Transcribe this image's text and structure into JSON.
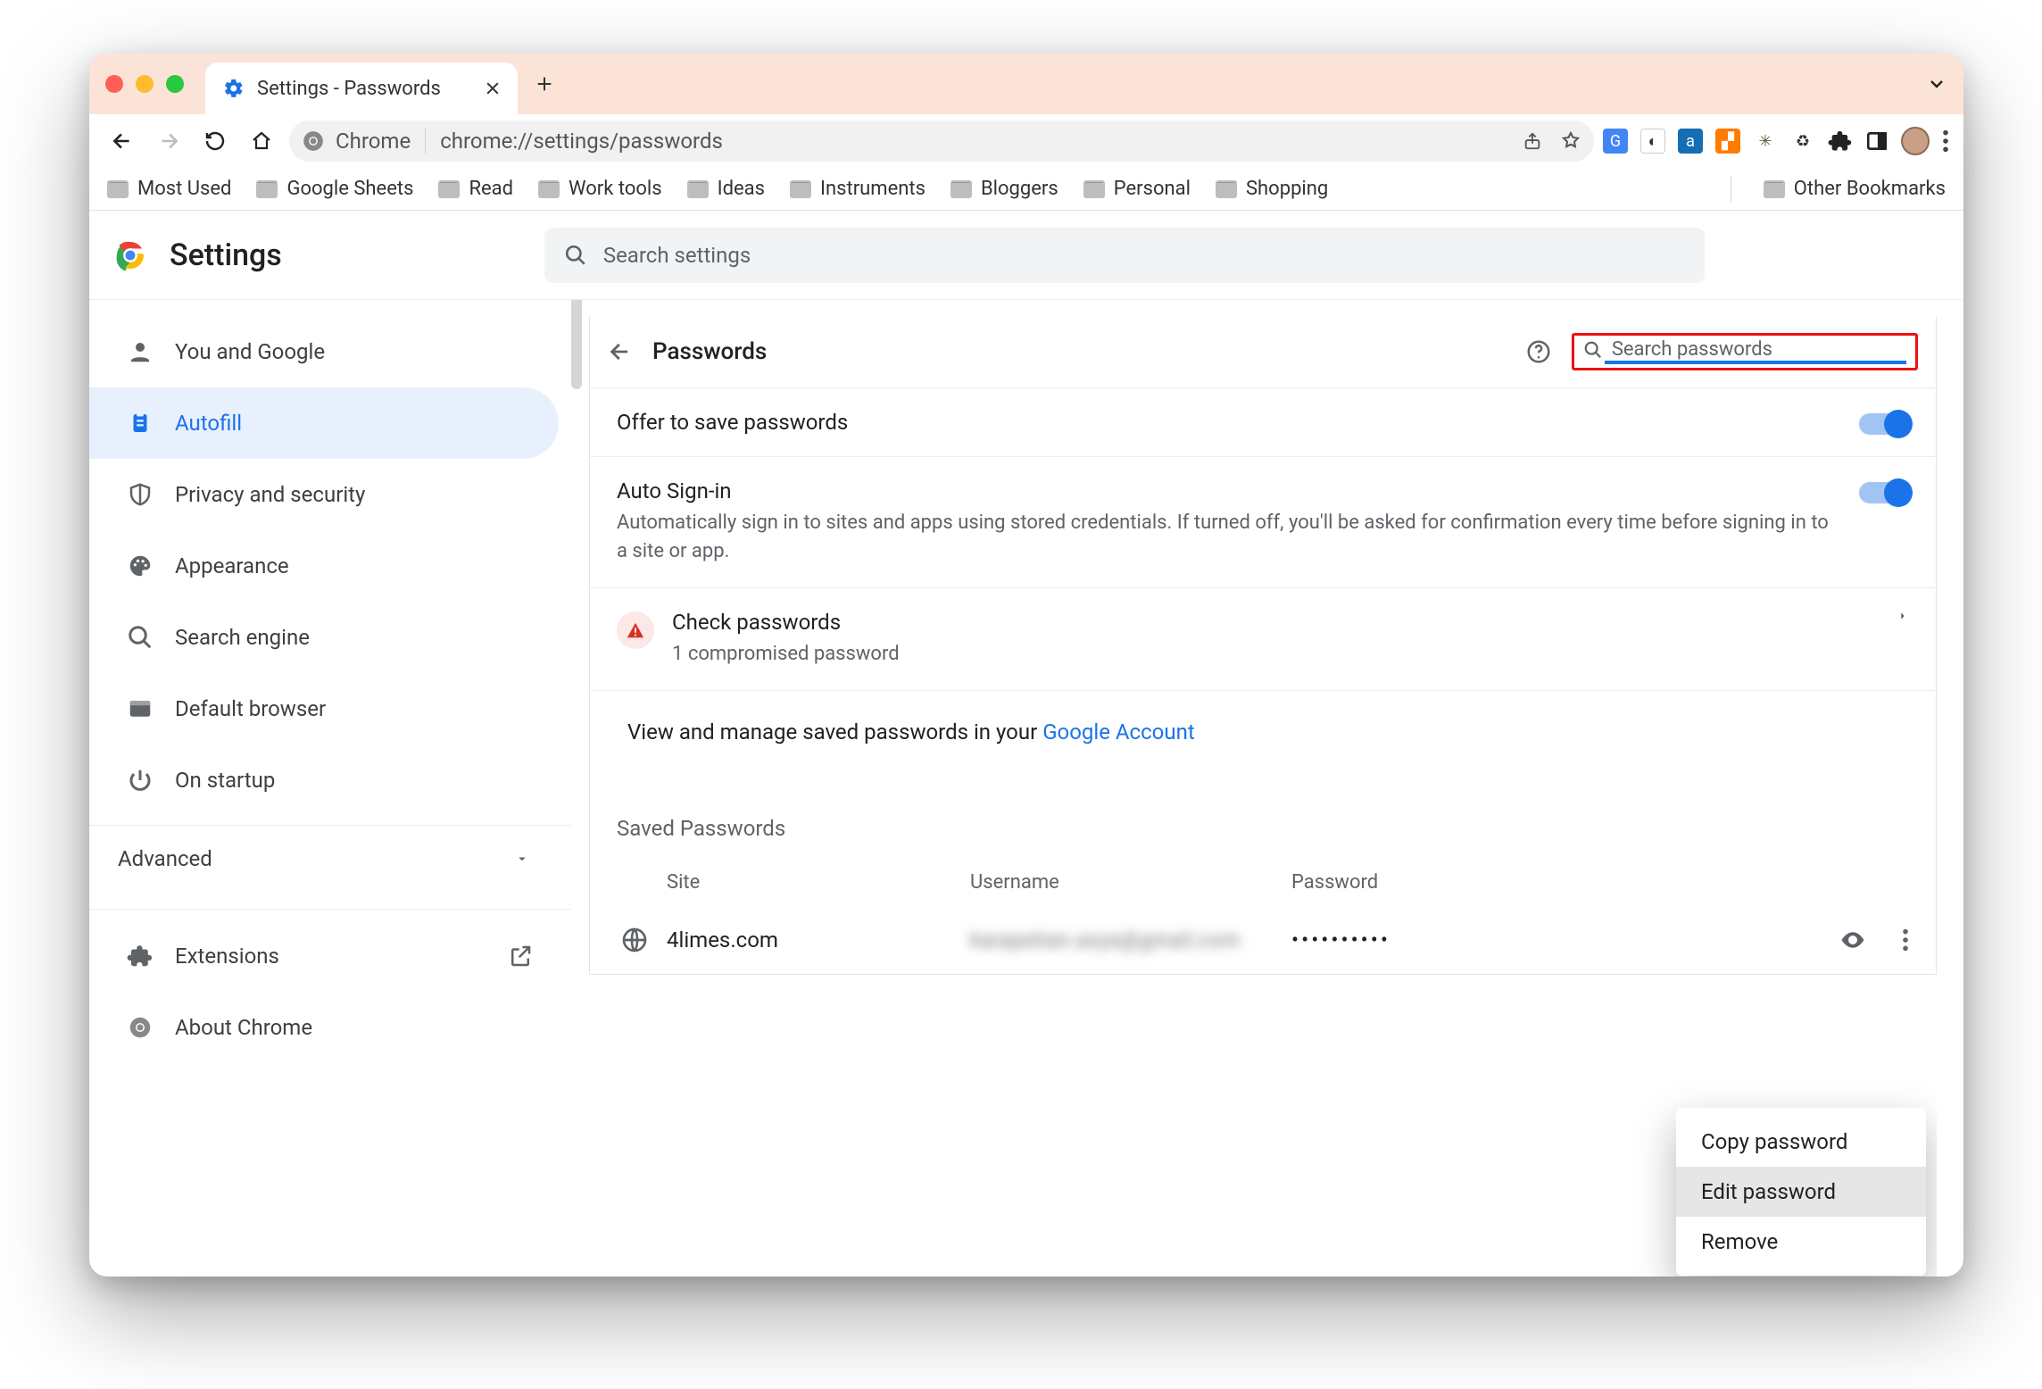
{
  "tab": {
    "title": "Settings - Passwords"
  },
  "omnibox": {
    "chip": "Chrome",
    "url": "chrome://settings/passwords"
  },
  "bookmarks": {
    "items": [
      "Most Used",
      "Google Sheets",
      "Read",
      "Work tools",
      "Ideas",
      "Instruments",
      "Bloggers",
      "Personal",
      "Shopping"
    ],
    "overflow": "Other Bookmarks"
  },
  "app": {
    "title": "Settings",
    "search_placeholder": "Search settings"
  },
  "sidebar": {
    "items": [
      {
        "label": "You and Google",
        "icon": "person"
      },
      {
        "label": "Autofill",
        "icon": "clipboard",
        "active": true
      },
      {
        "label": "Privacy and security",
        "icon": "shield"
      },
      {
        "label": "Appearance",
        "icon": "palette"
      },
      {
        "label": "Search engine",
        "icon": "magnify"
      },
      {
        "label": "Default browser",
        "icon": "window"
      },
      {
        "label": "On startup",
        "icon": "power"
      }
    ],
    "advanced": "Advanced",
    "footer": [
      {
        "label": "Extensions",
        "icon": "puzzle",
        "external": true
      },
      {
        "label": "About Chrome",
        "icon": "chrome"
      }
    ]
  },
  "page": {
    "title": "Passwords",
    "search_placeholder": "Search passwords",
    "offer_label": "Offer to save passwords",
    "autosign_label": "Auto Sign-in",
    "autosign_sub": "Automatically sign in to sites and apps using stored credentials. If turned off, you'll be asked for confirmation every time before signing in to a site or app.",
    "check_label": "Check passwords",
    "check_sub": "1 compromised password",
    "ga_pre": "View and manage saved passwords in your ",
    "ga_link": "Google Account",
    "saved_title": "Saved Passwords",
    "cols": {
      "site": "Site",
      "user": "Username",
      "pass": "Password"
    },
    "rows": [
      {
        "site": "4limes.com",
        "user": "karapetian.asya@gmail.com",
        "pass": "••••••••••"
      }
    ]
  },
  "context_menu": {
    "items": [
      "Copy password",
      "Edit password",
      "Remove"
    ],
    "hover_index": 1
  }
}
